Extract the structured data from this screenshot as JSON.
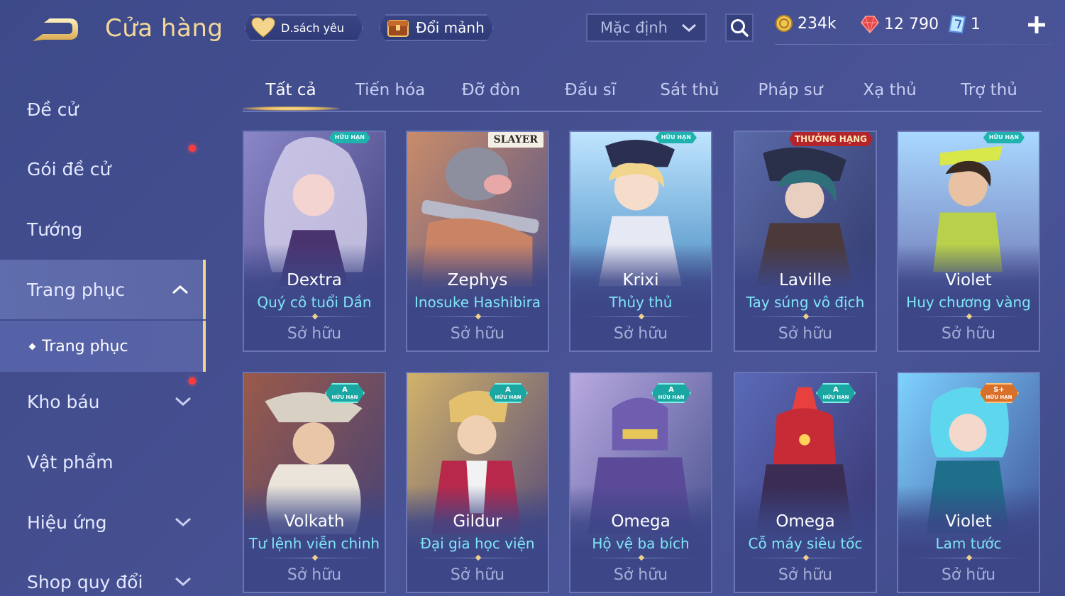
{
  "header": {
    "title": "Cửa hàng",
    "favorites_label": "D.sách yêu",
    "exchange_label": "Đổi mảnh",
    "sort_label": "Mặc định"
  },
  "currencies": {
    "gold": "234k",
    "vouchers": "12 790",
    "tickets": "1"
  },
  "sidebar": {
    "items": [
      {
        "label": "Đề cử"
      },
      {
        "label": "Gói đề cử"
      },
      {
        "label": "Tướng"
      },
      {
        "label": "Trang phục"
      },
      {
        "label": "Kho báu"
      },
      {
        "label": "Vật phẩm"
      },
      {
        "label": "Hiệu ứng"
      },
      {
        "label": "Shop quy đổi"
      }
    ],
    "sub_item": "Trang phục"
  },
  "tabs": [
    {
      "label": "Tất cả"
    },
    {
      "label": "Tiến hóa"
    },
    {
      "label": "Đỡ đòn"
    },
    {
      "label": "Đấu sĩ"
    },
    {
      "label": "Sát thủ"
    },
    {
      "label": "Pháp sư"
    },
    {
      "label": "Xạ thủ"
    },
    {
      "label": "Trợ thủ"
    }
  ],
  "owned_label": "Sở hữu",
  "cards": [
    {
      "hero": "Dextra",
      "skin": "Quý cô tuổi Dần",
      "badge": "HỮU HẠN"
    },
    {
      "hero": "Zephys",
      "skin": "Inosuke Hashibira",
      "badge": "SLAYER"
    },
    {
      "hero": "Krixi",
      "skin": "Thủy thủ",
      "badge": "HỮU HẠN"
    },
    {
      "hero": "Laville",
      "skin": "Tay súng vô địch",
      "badge": "THƯỞNG HẠNG"
    },
    {
      "hero": "Violet",
      "skin": "Huy chương vàng",
      "badge": "HỮU HẠN"
    },
    {
      "hero": "Volkath",
      "skin": "Tư lệnh viễn chinh",
      "tier": "A",
      "tier_note": "HỮU HẠN"
    },
    {
      "hero": "Gildur",
      "skin": "Đại gia học viện",
      "tier": "A",
      "tier_note": "HỮU HẠN"
    },
    {
      "hero": "Omega",
      "skin": "Hộ vệ ba bích",
      "tier": "A",
      "tier_note": "HỮU HẠN"
    },
    {
      "hero": "Omega",
      "skin": "Cỗ máy siêu tốc",
      "tier": "A",
      "tier_note": "HỮU HẠN"
    },
    {
      "hero": "Violet",
      "skin": "Lam tước",
      "tier": "S+",
      "tier_note": "HỮU HẠN"
    }
  ]
}
